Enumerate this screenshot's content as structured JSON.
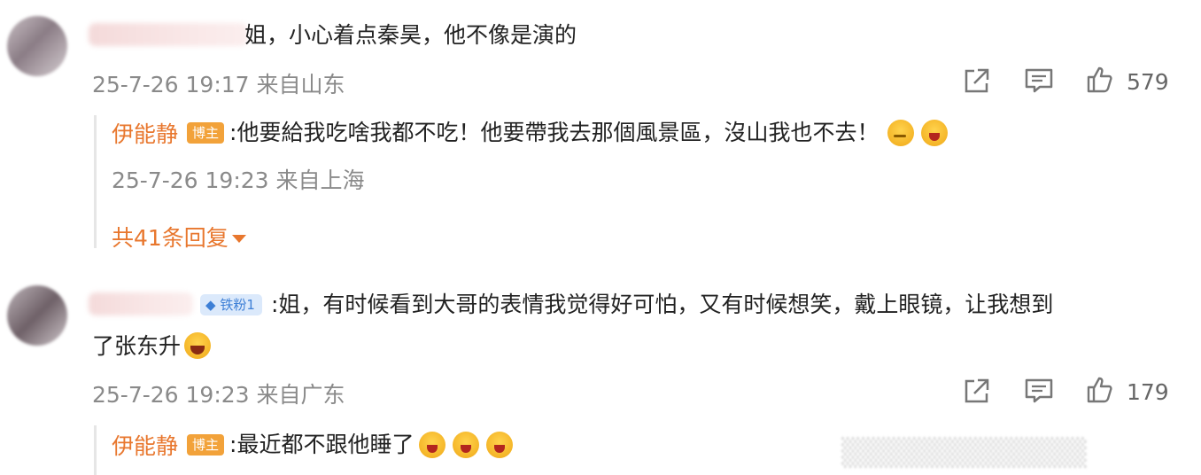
{
  "comments": [
    {
      "text": "姐，小心着点秦昊，他不像是演的",
      "timestamp": "25-7-26 19:17",
      "location": "来自山东",
      "likes": "579",
      "replies": [
        {
          "author": "伊能静",
          "badge": "博主",
          "text": ":他要給我吃啥我都不吃！他要帶我去那個風景區，沒山我也不去！",
          "emojis": [
            "think-emoji",
            "cry-emoji"
          ],
          "timestamp": "25-7-26 19:23",
          "location": "来自上海"
        }
      ],
      "more_replies": "共41条回复"
    },
    {
      "fan_badge": "铁粉1",
      "text_line1": ":姐，有时候看到大哥的表情我觉得好可怕，又有时候想笑，戴上眼镜，让我想到",
      "text_line2": "了张东升",
      "emoji": "laugh-emoji",
      "timestamp": "25-7-26 19:23",
      "location": "来自广东",
      "likes": "179",
      "replies": [
        {
          "author": "伊能静",
          "badge": "博主",
          "text": ":最近都不跟他睡了",
          "emojis": [
            "cry-emoji",
            "cry-emoji",
            "cry-emoji"
          ]
        }
      ]
    }
  ],
  "icons": {
    "share": "share-icon",
    "comment": "comment-icon",
    "like": "thumbs-up-icon"
  },
  "colors": {
    "author": "#e8772e",
    "meta": "#8a8a8a",
    "badge": "#f2a23a",
    "fan_badge_bg": "#dbe9fb"
  }
}
